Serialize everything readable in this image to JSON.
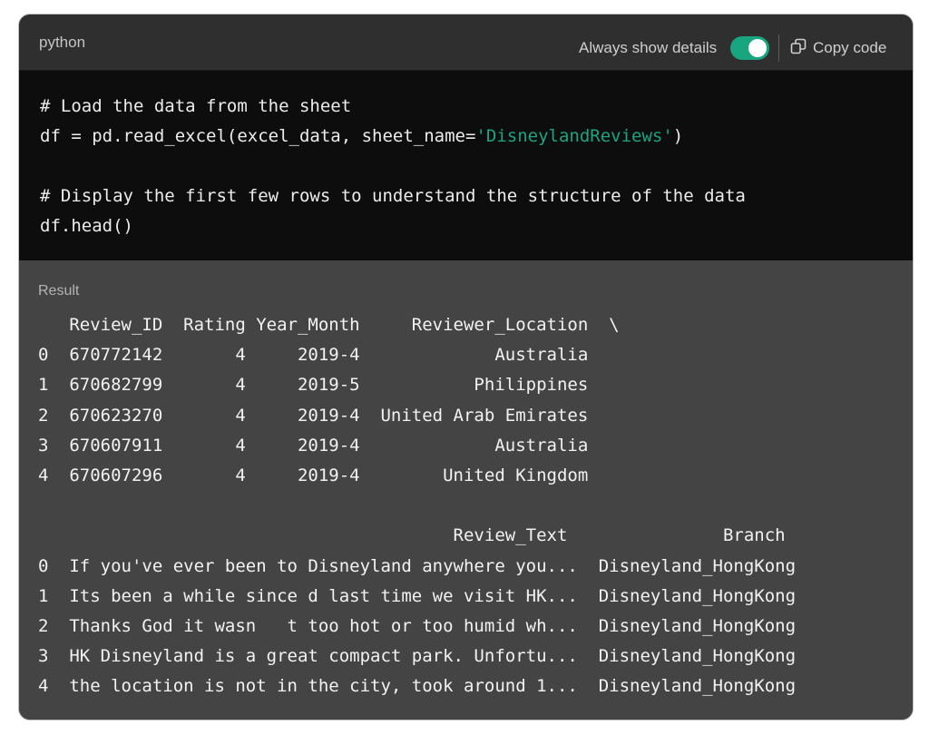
{
  "header": {
    "language": "python",
    "toggle_label": "Always show details",
    "toggle_on": true,
    "copy_label": "Copy code"
  },
  "code": {
    "line1": "# Load the data from the sheet",
    "line2_prefix": "df = pd.read_excel(excel_data, sheet_name=",
    "line2_string": "'DisneylandReviews'",
    "line2_suffix": ")",
    "line3": "# Display the first few rows to understand the structure of the data",
    "line4": "df.head()"
  },
  "result": {
    "label": "Result",
    "output_lines": [
      "   Review_ID  Rating Year_Month     Reviewer_Location  \\",
      "0  670772142       4     2019-4             Australia   ",
      "1  670682799       4     2019-5           Philippines   ",
      "2  670623270       4     2019-4  United Arab Emirates   ",
      "3  670607911       4     2019-4             Australia   ",
      "4  670607296       4     2019-4        United Kingdom   ",
      "",
      "                                        Review_Text               Branch  ",
      "0  If you've ever been to Disneyland anywhere you...  Disneyland_HongKong  ",
      "1  Its been a while since d last time we visit HK...  Disneyland_HongKong  ",
      "2  Thanks God it wasn   t too hot or too humid wh...  Disneyland_HongKong  ",
      "3  HK Disneyland is a great compact park. Unfortu...  Disneyland_HongKong  ",
      "4  the location is not in the city, took around 1...  Disneyland_HongKong  "
    ]
  },
  "colors": {
    "header_bg": "#2f2f2f",
    "code_bg": "#0d0d0d",
    "result_bg": "#444444",
    "accent": "#19a57f",
    "comment": "#8d8d8d"
  },
  "icons": {
    "copy": "copy-icon"
  }
}
